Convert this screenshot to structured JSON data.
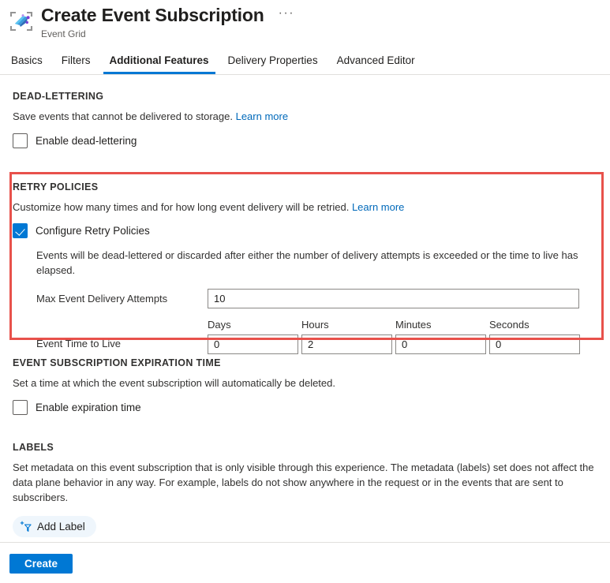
{
  "header": {
    "icon": "event-grid-icon",
    "title": "Create Event Subscription",
    "subtitle": "Event Grid",
    "more_menu": "···"
  },
  "tabs": [
    {
      "label": "Basics",
      "active": false
    },
    {
      "label": "Filters",
      "active": false
    },
    {
      "label": "Additional Features",
      "active": true
    },
    {
      "label": "Delivery Properties",
      "active": false
    },
    {
      "label": "Advanced Editor",
      "active": false
    }
  ],
  "dead_lettering": {
    "heading": "DEAD-LETTERING",
    "description": "Save events that cannot be delivered to storage.",
    "learn_more": "Learn more",
    "checkbox_label": "Enable dead-lettering",
    "checked": false
  },
  "retry_policies": {
    "heading": "RETRY POLICIES",
    "description": "Customize how many times and for how long event delivery will be retried.",
    "learn_more": "Learn more",
    "checkbox_label": "Configure Retry Policies",
    "checked": true,
    "note": "Events will be dead-lettered or discarded after either the number of delivery attempts is exceeded or the time to live has elapsed.",
    "max_attempts_label": "Max Event Delivery Attempts",
    "max_attempts_value": "10",
    "ttl_label": "Event Time to Live",
    "ttl_fields": [
      {
        "label": "Days",
        "value": "0"
      },
      {
        "label": "Hours",
        "value": "2"
      },
      {
        "label": "Minutes",
        "value": "0"
      },
      {
        "label": "Seconds",
        "value": "0"
      }
    ],
    "highlight_color": "#e8514b"
  },
  "expiration": {
    "heading": "EVENT SUBSCRIPTION EXPIRATION TIME",
    "description": "Set a time at which the event subscription will automatically be deleted.",
    "checkbox_label": "Enable expiration time",
    "checked": false
  },
  "labels": {
    "heading": "LABELS",
    "description_line1": "Set metadata on this event subscription that is only visible through this experience. The metadata (labels) set does not affect the data plane",
    "description_line2": "behavior in any way. For example, labels do not show anywhere in the request or in the events that are sent to subscribers.",
    "add_button_label": "Add Label",
    "add_button_icon": "add-tag-icon"
  },
  "footer": {
    "create_label": "Create"
  },
  "colors": {
    "accent": "#0078d4",
    "link": "#0069ba",
    "highlight": "#e8514b",
    "chip_bg": "#eff6fc"
  }
}
